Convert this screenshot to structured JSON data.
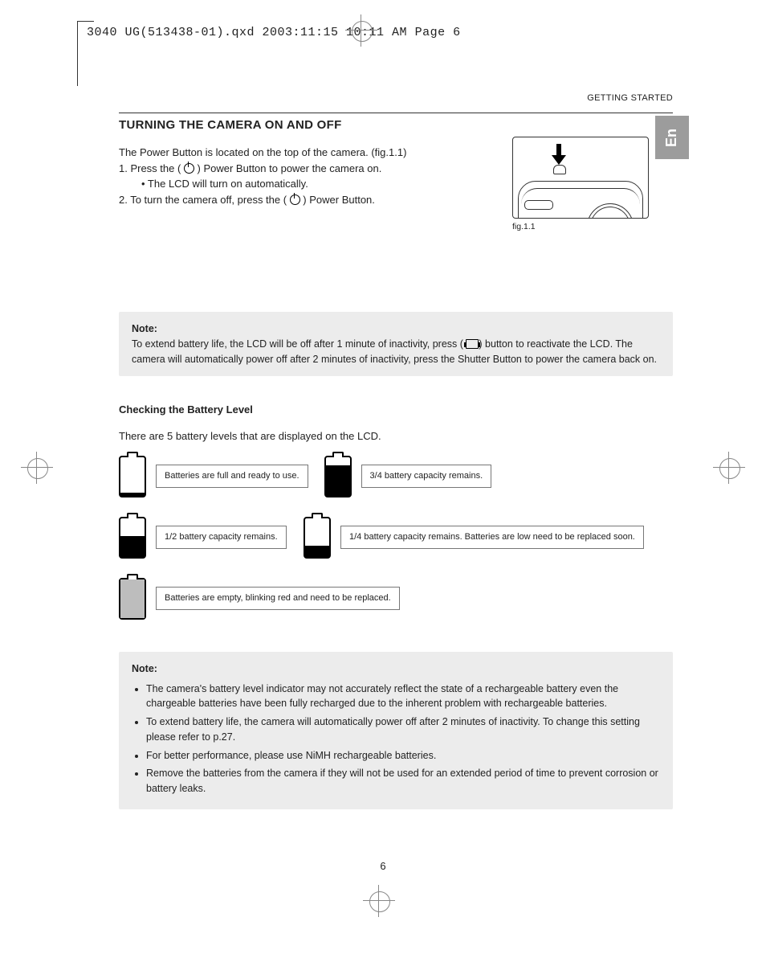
{
  "header_slug": "3040 UG(513438-01).qxd  2003:11:15  10:11 AM  Page 6",
  "breadcrumb": "GETTING STARTED",
  "lang_tab": "En",
  "section": {
    "title": "TURNING THE CAMERA ON AND OFF",
    "intro_line": "The Power Button is located on the top of the camera. (fig.1.1)",
    "step1_a": "1. Press the ( ",
    "step1_b": " ) Power Button to power the camera on.",
    "step1_sub": "•  The LCD will turn on automatically.",
    "step2_a": "2. To turn the camera off, press the ( ",
    "step2_b": " ) Power Button.",
    "fig_caption": "fig.1.1"
  },
  "note1": {
    "label": "Note:",
    "text_a": "To extend battery life, the LCD will be off after 1 minute of inactivity, press ( ",
    "text_b": ") button to reactivate the LCD.  The camera will automatically power off after 2 minutes of inactivity, press the Shutter Button to power the camera back on."
  },
  "battery_section": {
    "heading": "Checking the Battery Level",
    "intro": "There are 5 battery levels that are displayed on the LCD.",
    "levels": [
      {
        "label": "Batteries are full and ready to use.",
        "fill": 0
      },
      {
        "label": "3/4 battery capacity remains.",
        "fill": 10
      },
      {
        "label": "1/2 battery capacity remains.",
        "fill": 22
      },
      {
        "label": "1/4 battery capacity remains. Batteries are low need to be replaced soon.",
        "fill": 34
      },
      {
        "label": "Batteries are empty, blinking red and need to be replaced.",
        "fill": 44
      }
    ]
  },
  "note2": {
    "label": "Note:",
    "bullets": [
      "The camera's battery level indicator may not accurately reflect the state of a rechargeable battery even the chargeable batteries have been fully recharged due to the inherent problem with rechargeable batteries.",
      "To extend battery life, the camera will automatically power off after 2 minutes of inactivity. To change this setting please refer to p.27.",
      "For better performance, please use NiMH rechargeable batteries.",
      "Remove the batteries from the camera if they will not be used for an extended period of time to prevent corrosion or battery leaks."
    ]
  },
  "page_number": "6"
}
